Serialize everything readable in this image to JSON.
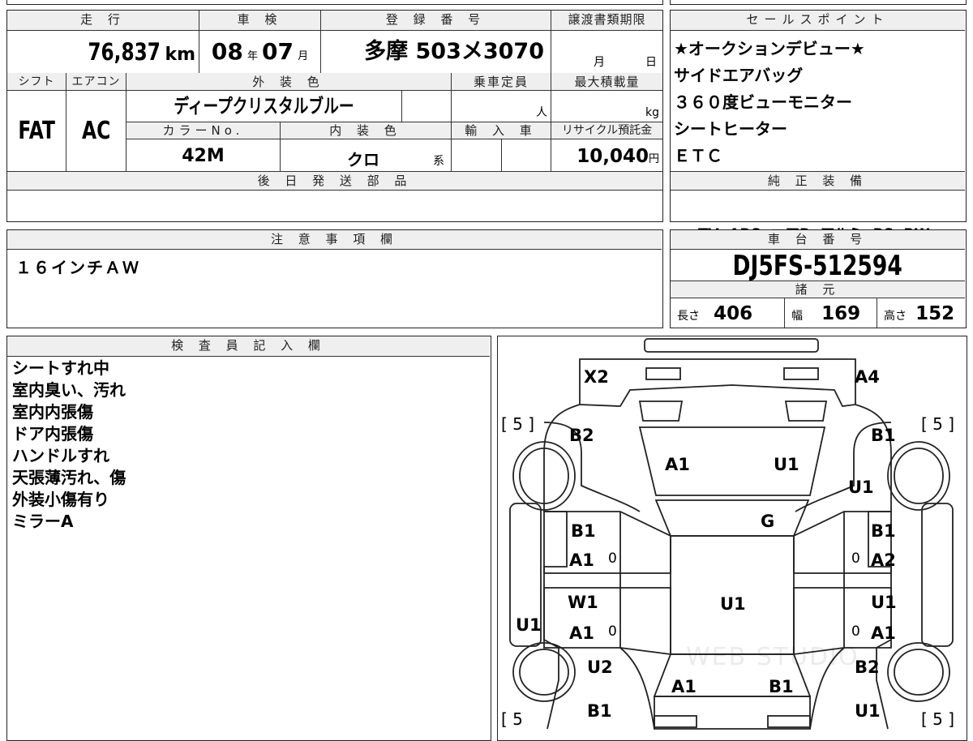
{
  "top_row": {
    "mileage_label": "走 行",
    "mileage": "76,837",
    "mileage_unit": "km",
    "shaken_label": "車 検",
    "shaken_year": "08",
    "shaken_year_unit": "年",
    "shaken_month": "07",
    "shaken_month_unit": "月",
    "reg_label": "登 録 番 号",
    "reg_number": "多摩 503メ3070",
    "transfer_label": "譲渡書類期限",
    "transfer_month_unit": "月",
    "transfer_day_unit": "日"
  },
  "second_row": {
    "shift_label": "シフト",
    "shift": "FAT",
    "ac_label": "エアコン",
    "ac": "AC",
    "exterior_label": "外 装 色",
    "exterior_color": "ディープクリスタルブルー",
    "capacity_label": "乗車定員",
    "capacity_unit": "人",
    "max_load_label": "最大積載量",
    "max_load_unit": "kg",
    "color_no_label": "カラーNo.",
    "color_no": "42M",
    "interior_label": "内 装 色",
    "interior_color": "クロ",
    "interior_suffix": "系",
    "import_label": "輸 入 車",
    "recycle_label": "リサイクル預託金",
    "recycle_fee": "10,040",
    "recycle_unit": "円"
  },
  "later_parts": {
    "label": "後 日 発 送 部 品",
    "value": ""
  },
  "sales_points": {
    "label": "セールスポイント",
    "items": [
      "★オークションデビュー★",
      "サイドエアバッグ",
      "３６０度ビューモニター",
      "シートヒーター",
      "ＥＴＣ"
    ]
  },
  "equipment": {
    "label": "純 正 装 備",
    "items": "TV  ABS  エアB  アルミ  PS  PW"
  },
  "caution": {
    "label": "注 意 事 項 欄",
    "text": "１６インチＡＷ"
  },
  "chassis": {
    "label": "車 台 番 号",
    "number": "DJ5FS-512594"
  },
  "specs": {
    "label": "諸 元",
    "length_label": "長さ",
    "length": "406",
    "width_label": "幅",
    "width": "169",
    "height_label": "高さ",
    "height": "152"
  },
  "inspector": {
    "label": "検 査 員 記 入 欄",
    "notes": [
      "シートすれ中",
      "室内臭い、汚れ",
      "室内内張傷",
      "ドア内張傷",
      "ハンドルすれ",
      "天張薄汚れ、傷",
      "外装小傷有り",
      "ミラーA"
    ]
  },
  "diagram": {
    "tire_left_top": "[ 5 ]",
    "tire_right_top": "[ 5 ]",
    "tire_left_bottom": "[ 5",
    "tire_right_bottom": "[ 5 ]",
    "marks": {
      "rear_left": "X2",
      "rear_right": "A4",
      "rear_quarter_left": "B2",
      "rear_quarter_right": "B1",
      "rear_glass_left": "A1",
      "rear_glass_right": "U1",
      "right_side_upper": "U1",
      "roof": "G",
      "rear_door_left_top": "B1",
      "rear_door_left_bottom": "A1",
      "rear_door_right_top": "B1",
      "rear_door_right_bottom": "A2",
      "front_door_left_top": "W1",
      "front_door_left_bottom": "A1",
      "front_door_right_top": "U1",
      "front_door_right_bottom": "A1",
      "left_step": "U1",
      "center": "U1",
      "front_fender_left": "U2",
      "front_fender_right": "B2",
      "hood_left": "A1",
      "hood_right": "B1",
      "front_left": "B1",
      "front_right": "U1",
      "zero1": "0",
      "zero2": "0",
      "zero3": "0",
      "zero4": "0"
    },
    "watermark": "WEB STUDIO"
  }
}
